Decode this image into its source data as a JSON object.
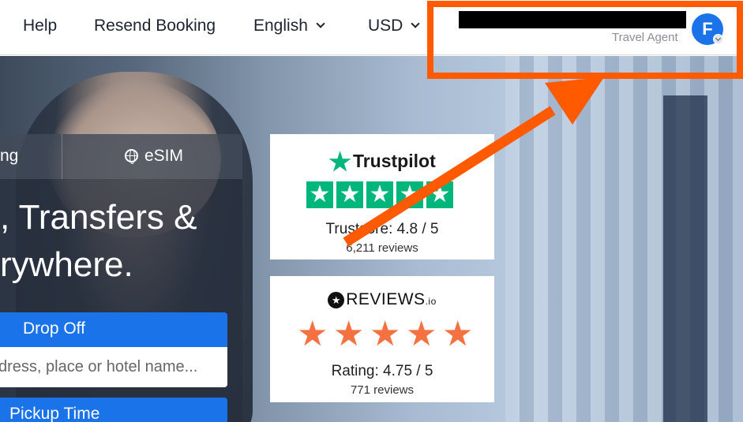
{
  "nav": {
    "help": "Help",
    "resend_booking": "Resend Booking",
    "language": "English",
    "currency": "USD"
  },
  "user": {
    "role": "Travel Agent",
    "avatar_initial": "F"
  },
  "search_panel": {
    "tab_partial": "ng",
    "tab_esim": "eSIM",
    "headline_line1": ", Transfers &",
    "headline_line2": "rywhere.",
    "dropoff_label": "Drop Off",
    "dropoff_placeholder": "dress, place or hotel name...",
    "pickup_time_label": "Pickup Time"
  },
  "trustpilot": {
    "brand": "Trustpilot",
    "score_text": "TrustScore: 4.8 / 5",
    "score_prefix": "Trusts",
    "score_suffix": "ore: 4.8 / 5",
    "reviews_text": "6,211 reviews",
    "stars": 5
  },
  "reviewsio": {
    "brand": "REVIEWS",
    "brand_suffix": ".io",
    "rating_text": "Rating: 4.75 / 5",
    "reviews_text": "771 reviews",
    "rating": 4.75
  },
  "colors": {
    "accent_blue": "#1a73e8",
    "trustpilot_green": "#00b67a",
    "reviews_orange": "#f57142",
    "annotation_orange": "#ff5a00"
  }
}
